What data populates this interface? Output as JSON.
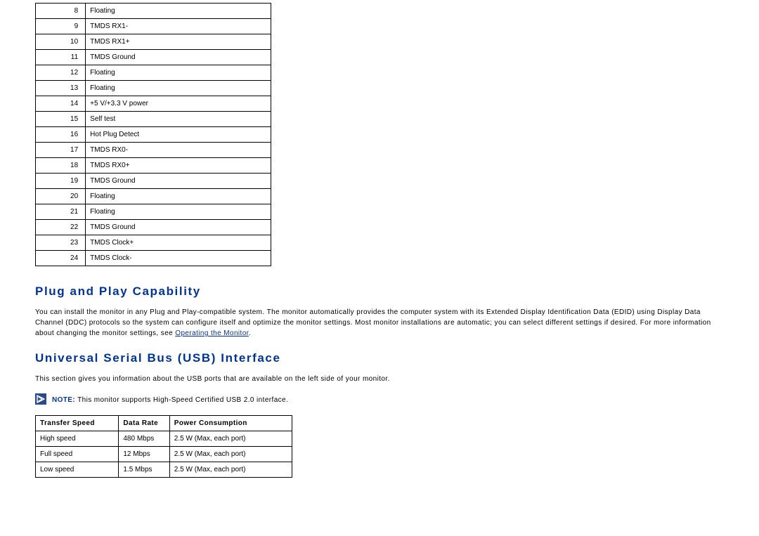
{
  "pin_table": {
    "rows": [
      {
        "pin": "8",
        "desc": "Floating"
      },
      {
        "pin": "9",
        "desc": "TMDS RX1-"
      },
      {
        "pin": "10",
        "desc": "TMDS RX1+"
      },
      {
        "pin": "11",
        "desc": "TMDS Ground"
      },
      {
        "pin": "12",
        "desc": "Floating"
      },
      {
        "pin": "13",
        "desc": "Floating"
      },
      {
        "pin": "14",
        "desc": "+5 V/+3.3 V power"
      },
      {
        "pin": "15",
        "desc": "Self test"
      },
      {
        "pin": "16",
        "desc": "Hot Plug Detect"
      },
      {
        "pin": "17",
        "desc": "TMDS RX0-"
      },
      {
        "pin": "18",
        "desc": "TMDS RX0+"
      },
      {
        "pin": "19",
        "desc": "TMDS Ground"
      },
      {
        "pin": "20",
        "desc": "Floating"
      },
      {
        "pin": "21",
        "desc": "Floating"
      },
      {
        "pin": "22",
        "desc": "TMDS Ground"
      },
      {
        "pin": "23",
        "desc": "TMDS Clock+"
      },
      {
        "pin": "24",
        "desc": "TMDS Clock-"
      }
    ]
  },
  "sections": {
    "plug_play": {
      "heading": "Plug and Play Capability",
      "body_pre": "You can install the monitor in any Plug and Play-compatible system. The monitor automatically provides the computer system with its Extended Display Identification Data (EDID) using Display Data Channel (DDC) protocols so the system can configure itself and optimize the monitor settings. Most monitor installations are automatic; you can select different settings if desired. For more information about changing the monitor settings, see ",
      "link_text": "Operating the Monitor",
      "body_post": "."
    },
    "usb": {
      "heading": "Universal Serial Bus (USB) Interface",
      "intro": "This section gives you information about the USB ports that are available on the left side of your monitor.",
      "note_label": "NOTE:",
      "note_text": " This monitor supports High-Speed Certified USB 2.0 interface.",
      "table": {
        "headers": {
          "speed": "Transfer Speed",
          "rate": "Data Rate",
          "power": "Power Consumption"
        },
        "rows": [
          {
            "speed": "High speed",
            "rate": "480 Mbps",
            "power": "2.5 W (Max, each port)"
          },
          {
            "speed": "Full speed",
            "rate": "12 Mbps",
            "power": "2.5 W (Max, each port)"
          },
          {
            "speed": "Low speed",
            "rate": "1.5 Mbps",
            "power": "2.5 W (Max, each port)"
          }
        ]
      }
    }
  }
}
